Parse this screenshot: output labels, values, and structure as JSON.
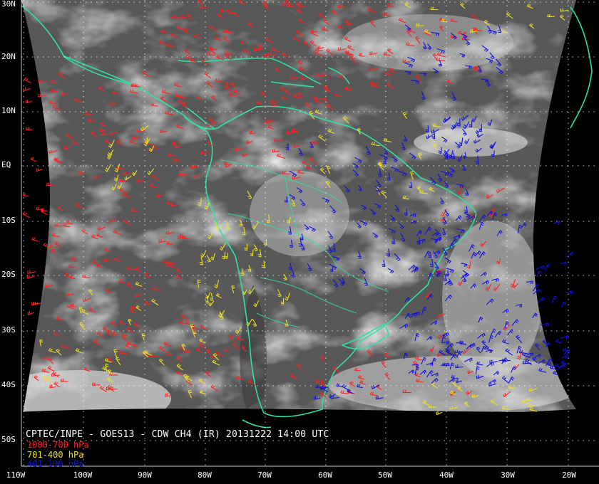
{
  "caption": "CPTEC/INPE - GOES13 - CDW CH4 (IR) 20131222 14:00 UTC",
  "legend": [
    {
      "label": "1000-700 hPa",
      "color": "#ff2020"
    },
    {
      "label": "701-400 hPa",
      "color": "#f0e020"
    },
    {
      "label": "401-100 hPa",
      "color": "#1010e0"
    }
  ],
  "colors": {
    "coast": "#30e0a0",
    "grid": "#ffffff",
    "background": "#000000"
  },
  "lat_labels": [
    "30N",
    "20N",
    "10N",
    "EQ",
    "10S",
    "20S",
    "30S",
    "40S",
    "50S"
  ],
  "lon_labels": [
    "110W",
    "100W",
    "90W",
    "80W",
    "70W",
    "60W",
    "50W",
    "40W",
    "30W",
    "20W"
  ]
}
